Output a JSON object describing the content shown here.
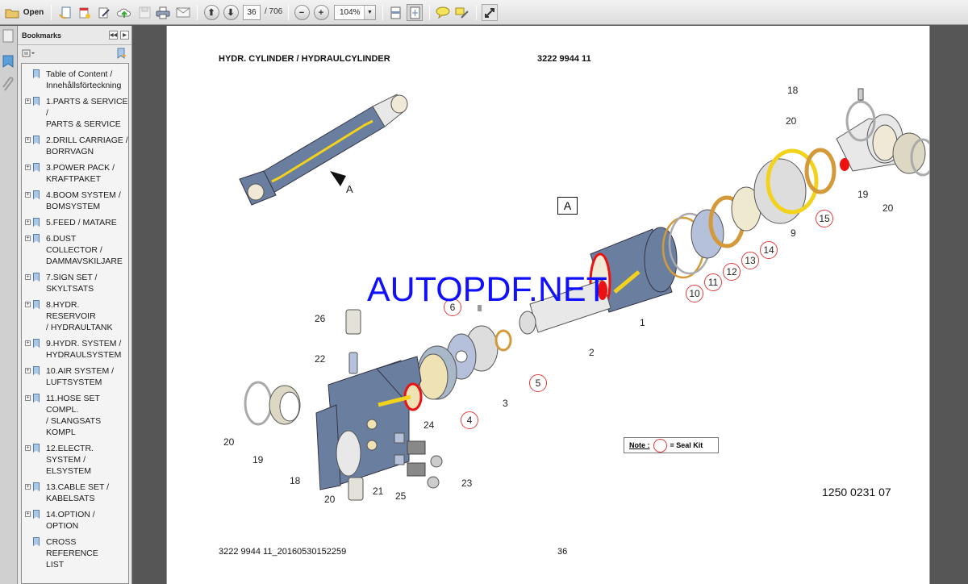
{
  "toolbar": {
    "open_label": "Open",
    "page_current": "36",
    "page_total": "/ 706",
    "zoom_value": "104%",
    "icons": [
      "folder-open-icon",
      "create-pdf-icon",
      "combine-files-icon",
      "edit-icon",
      "upload-cloud-icon",
      "save-icon",
      "print-icon",
      "email-icon",
      "previous-page-icon",
      "next-page-icon",
      "zoom-out-icon",
      "zoom-in-icon",
      "fit-width-icon",
      "fit-page-icon",
      "comment-icon",
      "highlight-icon",
      "fullscreen-icon"
    ]
  },
  "sidebar": {
    "title": "Bookmarks",
    "bookmarks": [
      {
        "label": "Table of Content /\nInnehållsförteckning",
        "expandable": false
      },
      {
        "label": "1.PARTS & SERVICE /\nPARTS & SERVICE",
        "expandable": true
      },
      {
        "label": "2.DRILL CARRIAGE /\nBORRVAGN",
        "expandable": true
      },
      {
        "label": "3.POWER PACK /\nKRAFTPAKET",
        "expandable": true
      },
      {
        "label": "4.BOOM SYSTEM /\nBOMSYSTEM",
        "expandable": true
      },
      {
        "label": "5.FEED / MATARE",
        "expandable": true
      },
      {
        "label": "6.DUST COLLECTOR /\nDAMMAVSKILJARE",
        "expandable": true
      },
      {
        "label": "7.SIGN SET /\nSKYLTSATS",
        "expandable": true
      },
      {
        "label": "8.HYDR. RESERVOIR\n/ HYDRAULTANK",
        "expandable": true
      },
      {
        "label": "9.HYDR. SYSTEM /\nHYDRAULSYSTEM",
        "expandable": true
      },
      {
        "label": "10.AIR SYSTEM /\nLUFTSYSTEM",
        "expandable": true
      },
      {
        "label": "11.HOSE SET COMPL.\n/ SLANGSATS KOMPL",
        "expandable": true
      },
      {
        "label": "12.ELECTR. SYSTEM /\nELSYSTEM",
        "expandable": true
      },
      {
        "label": "13.CABLE SET /\nKABELSATS",
        "expandable": true
      },
      {
        "label": "14.OPTION / OPTION",
        "expandable": true
      },
      {
        "label": "CROSS REFERENCE\nLIST",
        "expandable": false
      }
    ]
  },
  "document": {
    "title": "HYDR. CYLINDER / HYDRAULCYLINDER",
    "part_number": "3222 9944 11",
    "view_label": "A",
    "view_arrow_label": "A",
    "drawing_number": "1250 0231 07",
    "footer_left": "3222 9944 11_20160530152259",
    "footer_page": "36",
    "note_label": "Note :",
    "note_text": "= Seal Kit",
    "watermark": "AUTOPDF.NET",
    "callouts": [
      "1",
      "2",
      "3",
      "9",
      "18",
      "19",
      "20",
      "20",
      "19",
      "20",
      "21",
      "22",
      "23",
      "24",
      "25",
      "26",
      "18",
      "20"
    ],
    "seal_callouts": [
      "4",
      "5",
      "6",
      "10",
      "11",
      "12",
      "13",
      "14",
      "15"
    ]
  },
  "colors": {
    "cylinder_blue": "#6a7fa0",
    "hose_yellow": "#f2d21b",
    "seal_red": "#e23b3b",
    "watermark_blue": "#1010ff"
  }
}
